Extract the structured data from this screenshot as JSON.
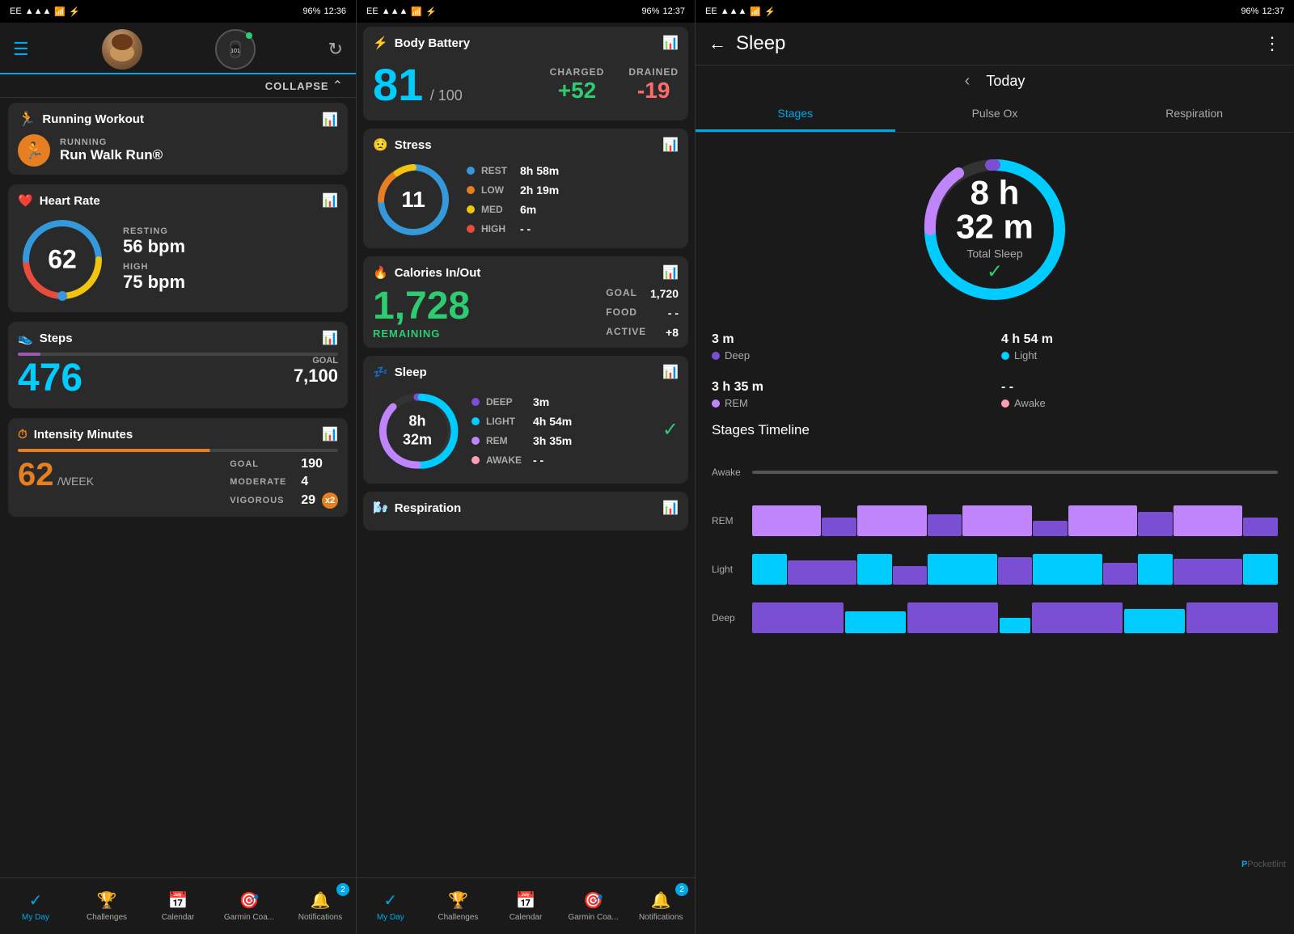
{
  "panel1": {
    "statusbar": {
      "carrier": "EE",
      "signal": "▲▲▲",
      "wifi": "⊙",
      "bt": "⚡",
      "battery": "96%",
      "time": "12:36"
    },
    "header": {
      "menu_icon": "☰",
      "refresh_icon": "↻"
    },
    "collapse_label": "COLLAPSE",
    "running_workout": {
      "title": "Running Workout",
      "label": "RUNNING",
      "name": "Run Walk Run®"
    },
    "heart_rate": {
      "title": "Heart Rate",
      "current": "62",
      "resting_label": "RESTING",
      "resting_value": "56 bpm",
      "high_label": "HIGH",
      "high_value": "75 bpm"
    },
    "steps": {
      "title": "Steps",
      "value": "476",
      "goal_label": "GOAL",
      "goal_value": "7,100"
    },
    "intensity": {
      "title": "Intensity Minutes",
      "value": "62",
      "week_label": "/WEEK",
      "goal_label": "GOAL",
      "goal_value": "190",
      "moderate_label": "MODERATE",
      "moderate_value": "4",
      "vigorous_label": "VIGOROUS",
      "vigorous_value": "29",
      "vigorous_badge": "x2"
    },
    "nav": {
      "items": [
        {
          "label": "My Day",
          "icon": "✓",
          "active": true
        },
        {
          "label": "Challenges",
          "icon": "🏆",
          "active": false
        },
        {
          "label": "Calendar",
          "icon": "📅",
          "active": false
        },
        {
          "label": "Garmin Coa...",
          "icon": "🎯",
          "active": false
        },
        {
          "label": "Notifications",
          "icon": "🔔",
          "active": false,
          "badge": "2"
        }
      ]
    }
  },
  "panel_middle": {
    "statusbar": {
      "carrier": "EE",
      "battery": "96%",
      "time": "12:37"
    },
    "body_battery": {
      "title": "Body Battery",
      "value": "81",
      "of100": "/ 100",
      "charged_label": "CHARGED",
      "charged_value": "+52",
      "drained_label": "DRAINED",
      "drained_value": "-19"
    },
    "stress": {
      "title": "Stress",
      "value": "11",
      "rest_label": "REST",
      "rest_value": "8h 58m",
      "low_label": "LOW",
      "low_value": "2h 19m",
      "med_label": "MED",
      "med_value": "6m",
      "high_label": "HIGH",
      "high_value": "- -"
    },
    "calories": {
      "title": "Calories In/Out",
      "value": "1,728",
      "remaining_label": "REMAINING",
      "goal_label": "GOAL",
      "goal_value": "1,720",
      "food_label": "FOOD",
      "food_value": "- -",
      "active_label": "ACTIVE",
      "active_value": "+8"
    },
    "sleep": {
      "title": "Sleep",
      "time": "8h 32m",
      "deep_label": "DEEP",
      "deep_value": "3m",
      "light_label": "LIGHT",
      "light_value": "4h 54m",
      "rem_label": "REM",
      "rem_value": "3h 35m",
      "awake_label": "AWAKE",
      "awake_value": "- -"
    },
    "respiration": {
      "title": "Respiration"
    },
    "nav": {
      "items": [
        {
          "label": "My Day",
          "icon": "✓",
          "active": true
        },
        {
          "label": "Challenges",
          "icon": "🏆",
          "active": false
        },
        {
          "label": "Calendar",
          "icon": "📅",
          "active": false
        },
        {
          "label": "Garmin Coa...",
          "icon": "🎯",
          "active": false
        },
        {
          "label": "Notifications",
          "icon": "🔔",
          "active": false,
          "badge": "2"
        }
      ]
    }
  },
  "panel_right": {
    "statusbar": {
      "carrier": "EE",
      "battery": "96%",
      "time": "12:37"
    },
    "header": {
      "back": "←",
      "title": "Sleep",
      "more": "⋮"
    },
    "nav_today": "Today",
    "tabs": [
      "Stages",
      "Pulse Ox",
      "Respiration"
    ],
    "active_tab": "Stages",
    "total_sleep_time": "8 h 32 m",
    "total_sleep_label": "Total Sleep",
    "sleep_stages": [
      {
        "label": "3 m",
        "type": "Deep",
        "color": "#7b4fd4"
      },
      {
        "label": "4 h 54 m",
        "type": "Light",
        "color": "#00ccff"
      },
      {
        "label": "3 h 35 m",
        "type": "REM",
        "color": "#c084fc"
      },
      {
        "label": "- -",
        "type": "Awake",
        "color": "#ff9eb5"
      }
    ],
    "stages_title": "Stages Timeline",
    "timeline_rows": [
      {
        "label": "Awake"
      },
      {
        "label": "REM"
      },
      {
        "label": "Light"
      },
      {
        "label": "Deep"
      }
    ],
    "pocketlint": "Pocketlint"
  }
}
